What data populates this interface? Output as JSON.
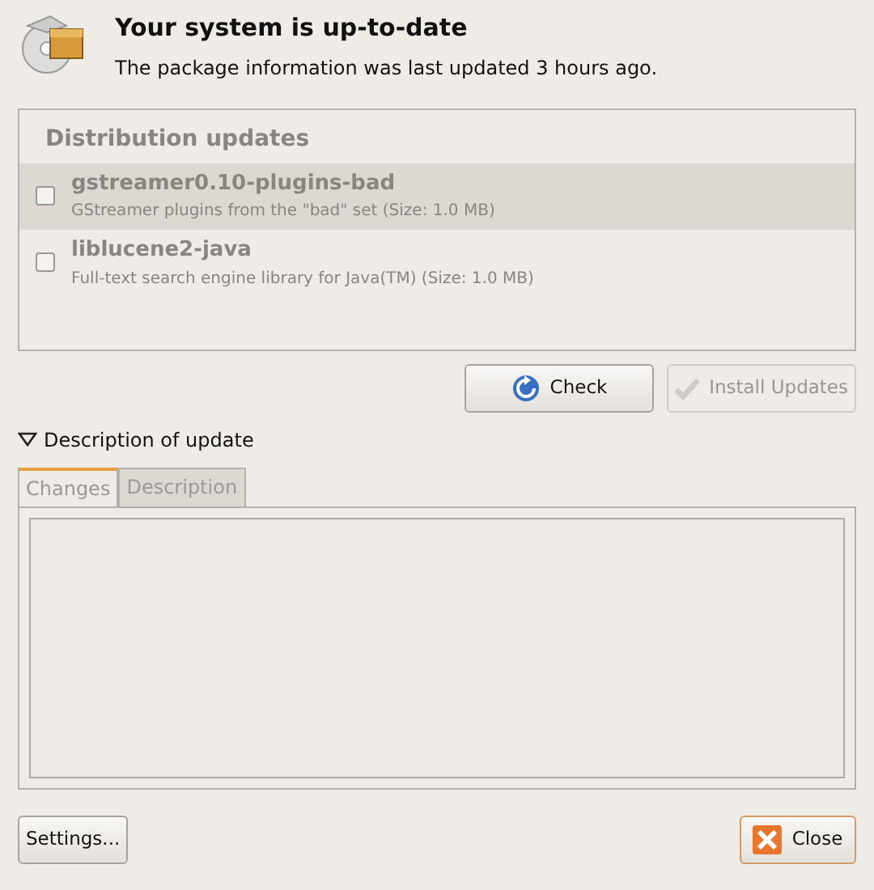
{
  "header": {
    "title": "Your system is up-to-date",
    "subtitle": "The package information was last updated 3 hours ago."
  },
  "updates": {
    "disabled": true,
    "group": "Distribution updates",
    "items": [
      {
        "name": "gstreamer0.10-plugins-bad",
        "description": "GStreamer plugins from the \"bad\" set (Size: 1.0 MB)",
        "checked": false,
        "selected": true
      },
      {
        "name": "liblucene2-java",
        "description": "Full-text search engine library for Java(TM) (Size: 1.0 MB)",
        "checked": false,
        "selected": false
      }
    ]
  },
  "actions": [
    {
      "label": "Check",
      "kind": "check",
      "disabled": false
    },
    {
      "label": "Install Updates",
      "kind": "install",
      "disabled": true
    }
  ],
  "expander": {
    "label": "Description of update",
    "expanded": true
  },
  "tabs": [
    {
      "label": "Changes",
      "selected": true
    },
    {
      "label": "Description",
      "selected": false
    }
  ],
  "footer": [
    {
      "label": "Settings...",
      "kind": "plain"
    },
    {
      "label": "Close",
      "kind": "close"
    }
  ]
}
